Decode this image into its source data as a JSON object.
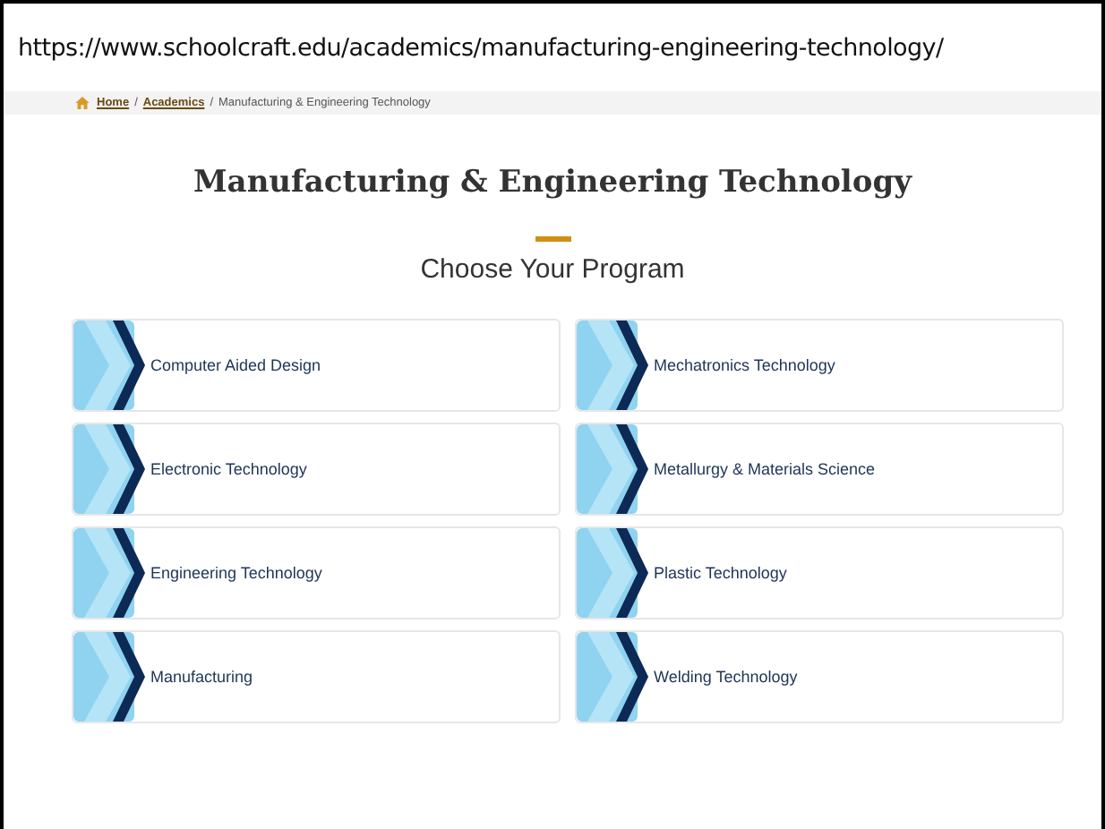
{
  "address_bar": {
    "url": "https://www.schoolcraft.edu/academics/manufacturing-engineering-technology/"
  },
  "breadcrumb": {
    "separator": "/",
    "items": [
      {
        "label": "Home",
        "kind": "home"
      },
      {
        "label": "Academics",
        "kind": "link"
      },
      {
        "label": "Manufacturing & Engineering Technology",
        "kind": "current"
      }
    ]
  },
  "page_title": "Manufacturing & Engineering Technology",
  "subtitle": "Choose Your Program",
  "programs": [
    {
      "label": "Computer Aided Design"
    },
    {
      "label": "Mechatronics Technology"
    },
    {
      "label": "Electronic Technology"
    },
    {
      "label": "Metallurgy & Materials Science"
    },
    {
      "label": "Engineering Technology"
    },
    {
      "label": "Plastic Technology"
    },
    {
      "label": "Manufacturing"
    },
    {
      "label": "Welding Technology"
    }
  ]
}
